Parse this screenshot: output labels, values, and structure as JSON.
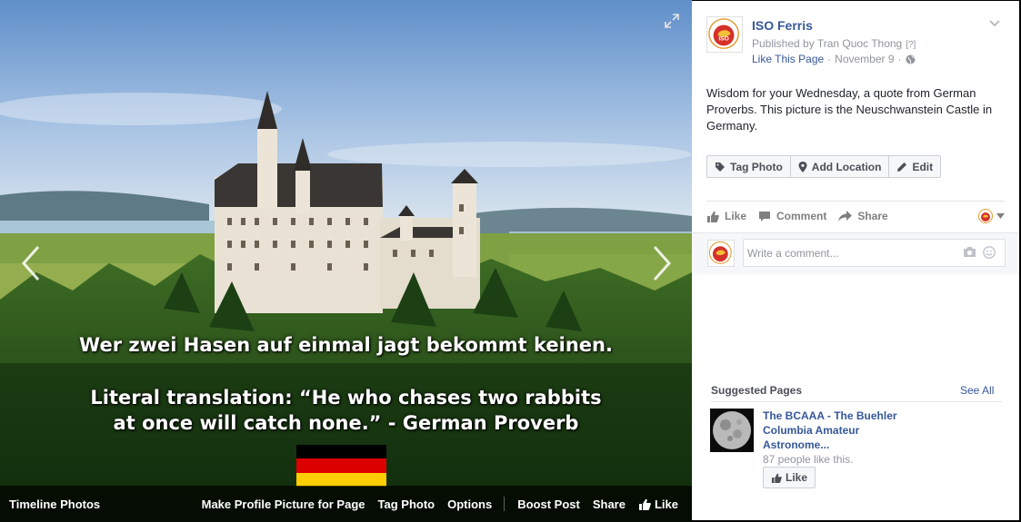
{
  "photo": {
    "caption_line1": "Wer zwei Hasen auf einmal jagt bekommt keinen.",
    "caption_line2": "Literal translation: “He who chases two rabbits",
    "caption_line3": "at once will catch none.” - German Proverb",
    "flag_colors": [
      "#000000",
      "#dd0000",
      "#ffce00"
    ]
  },
  "photo_bar": {
    "album": "Timeline Photos",
    "make_profile": "Make Profile Picture for Page",
    "tag_photo": "Tag Photo",
    "options": "Options",
    "boost_post": "Boost Post",
    "share": "Share",
    "like": "Like"
  },
  "post": {
    "page_name": "ISO Ferris",
    "published_by": "Published by Tran Quoc Thong",
    "help": "[?]",
    "like_page": "Like This Page",
    "date": "November 9",
    "text": "Wisdom for your Wednesday, a quote from German Proverbs. This picture is the Neuschwanstein Castle in Germany."
  },
  "photo_tools": {
    "tag_photo": "Tag Photo",
    "add_location": "Add Location",
    "edit": "Edit"
  },
  "ufi": {
    "like": "Like",
    "comment": "Comment",
    "share": "Share"
  },
  "comment": {
    "placeholder": "Write a comment..."
  },
  "suggested": {
    "header": "Suggested Pages",
    "see_all": "See All",
    "page_name": "The BCAAA - The Buehler Columbia Amateur Astronome...",
    "likes": "87 people like this.",
    "like_button": "Like"
  },
  "colors": {
    "link": "#365899",
    "muted": "#90949c",
    "brand_red": "#d4312a"
  }
}
